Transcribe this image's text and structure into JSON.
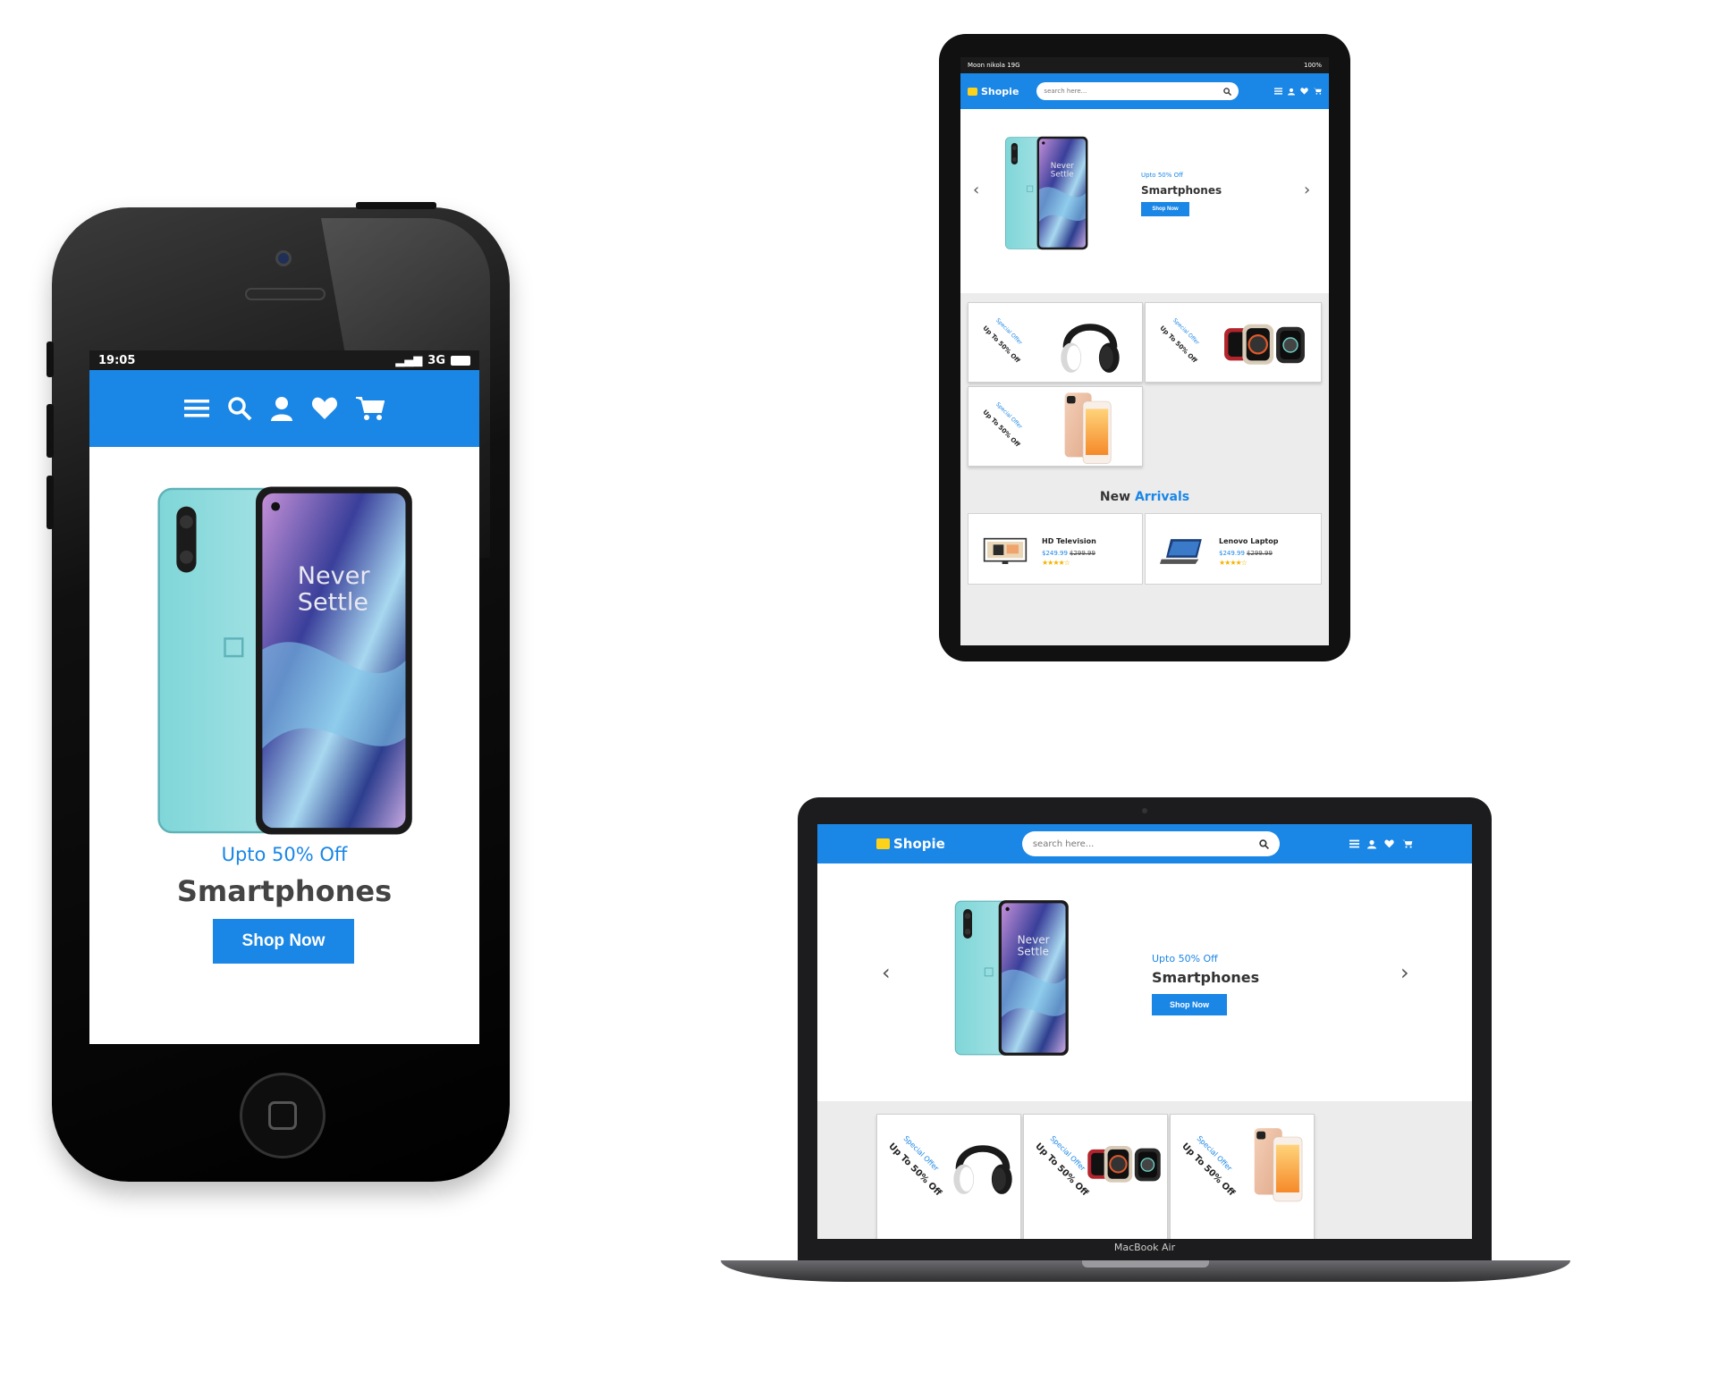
{
  "brand": {
    "name": "Shopie",
    "accent": "#1a86e6",
    "logo_color": "#ffd21a"
  },
  "search": {
    "placeholder": "search here..."
  },
  "nav_icons": [
    "menu-icon",
    "search-icon",
    "user-icon",
    "heart-icon",
    "cart-icon"
  ],
  "hero": {
    "offer": "Upto 50% Off",
    "title": "Smartphones",
    "button": "Shop Now",
    "image_text": "Never Settle"
  },
  "phone": {
    "status_time": "19:05",
    "status_network": "3G"
  },
  "tablet": {
    "status_left": "Moon nikola 19G",
    "status_right": "100%"
  },
  "special_offers": [
    {
      "label": "Special Offer",
      "discount": "Up To 50% Off",
      "product": "headphones"
    },
    {
      "label": "Special Offer",
      "discount": "Up To 50% Off",
      "product": "smartwatch"
    },
    {
      "label": "Special Offer",
      "discount": "Up To 50% Off",
      "product": "smartphone"
    }
  ],
  "new_arrivals": {
    "heading_prefix": "New",
    "heading_highlight": "Arrivals",
    "items": [
      {
        "name": "HD Television",
        "price": "$249.99",
        "old_price": "$299.99",
        "rating": 4.5
      },
      {
        "name": "Lenovo Laptop",
        "price": "$249.99",
        "old_price": "$299.99",
        "rating": 4.5
      }
    ]
  },
  "laptop": {
    "model_label": "MacBook Air"
  }
}
